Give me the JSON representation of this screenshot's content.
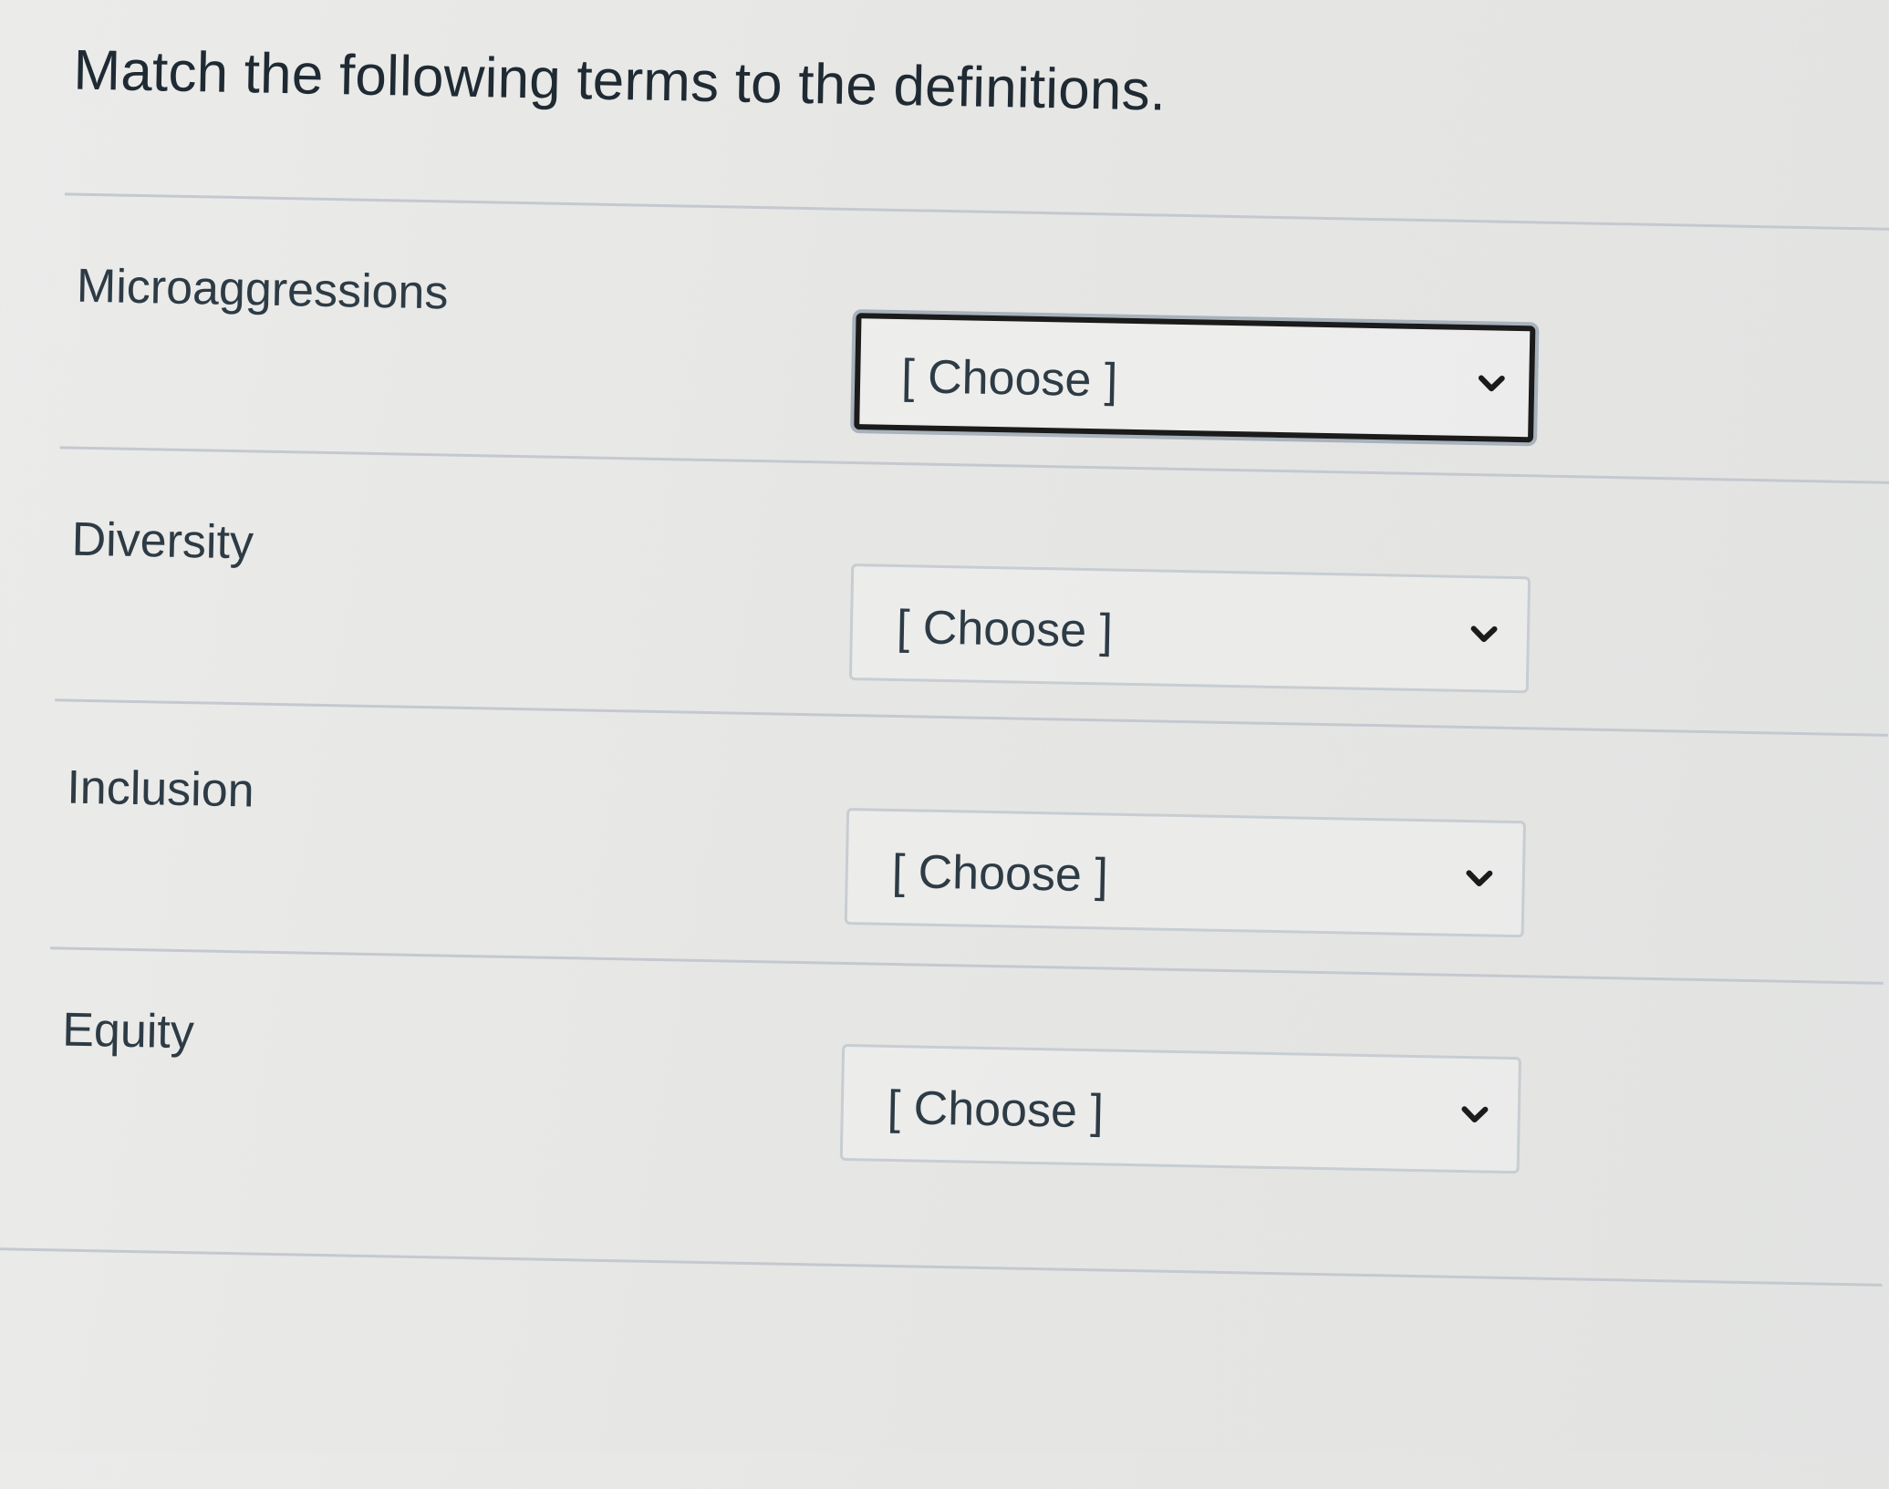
{
  "question": {
    "prompt": "Match the following terms to the definitions."
  },
  "rows": [
    {
      "term": "Microaggressions",
      "selected": "[ Choose ]",
      "focused": true
    },
    {
      "term": "Diversity",
      "selected": "[ Choose ]",
      "focused": false
    },
    {
      "term": "Inclusion",
      "selected": "[ Choose ]",
      "focused": false
    },
    {
      "term": "Equity",
      "selected": "[ Choose ]",
      "focused": false
    }
  ],
  "icons": {
    "dropdown": "chevron-down-icon"
  },
  "colors": {
    "text": "#2d3b45",
    "border": "#c7cdd1",
    "focus_border": "#1b1b1b",
    "background": "#e8e8e7"
  }
}
